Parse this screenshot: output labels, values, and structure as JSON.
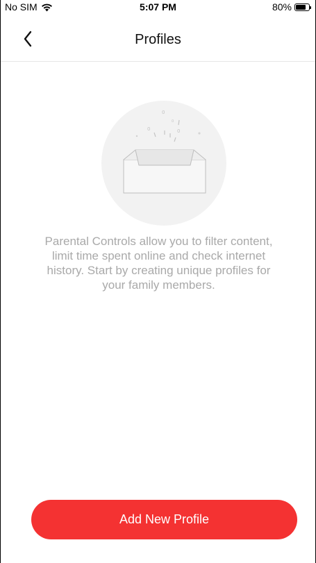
{
  "status_bar": {
    "carrier": "No SIM",
    "time": "5:07 PM",
    "battery": "80%",
    "battery_level": 0.8
  },
  "nav": {
    "back_icon": "chevron-left-icon",
    "title": "Profiles"
  },
  "empty_state": {
    "illustration_icon": "empty-tray-icon",
    "illustration_digits": [
      "0",
      "0",
      "0",
      "0"
    ],
    "description": "Parental Controls allow you to filter content, limit time spent online and check internet history. Start by creating unique profiles for your family members."
  },
  "actions": {
    "add_profile_label": "Add New Profile"
  },
  "colors": {
    "accent": "#f43232",
    "text_muted": "#a9a9a9",
    "illustration_bg": "#f2f2f2"
  }
}
